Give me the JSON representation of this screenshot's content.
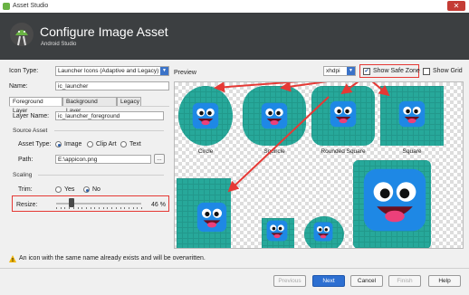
{
  "window": {
    "title": "Asset Studio",
    "close": "✕"
  },
  "header": {
    "title": "Configure Image Asset",
    "subtitle": "Android Studio"
  },
  "form": {
    "icon_type_label": "Icon Type:",
    "icon_type_value": "Launcher Icons (Adaptive and Legacy)",
    "name_label": "Name:",
    "name_value": "ic_launcher",
    "tabs": [
      "Foreground Layer",
      "Background Layer",
      "Legacy"
    ],
    "layer_name_label": "Layer Name:",
    "layer_name_value": "ic_launcher_foreground",
    "source_asset_label": "Source Asset",
    "asset_type_label": "Asset Type:",
    "asset_type_options": [
      "Image",
      "Clip Art",
      "Text"
    ],
    "asset_type_selected": "Image",
    "path_label": "Path:",
    "path_value": "E:\\appicon.png",
    "browse": "...",
    "scaling_label": "Scaling",
    "trim_label": "Trim:",
    "trim_options": [
      "Yes",
      "No"
    ],
    "trim_selected": "No",
    "resize_label": "Resize:",
    "resize_value": "46 %",
    "resize_fraction": 0.46
  },
  "preview": {
    "label": "Preview",
    "density_value": "xhdpi",
    "show_safe_zone": {
      "label": "Show Safe Zone",
      "checked": true
    },
    "show_grid": {
      "label": "Show Grid",
      "checked": false
    },
    "shapes": [
      "Circle",
      "Squircle",
      "Rounded Square",
      "Square"
    ]
  },
  "status": {
    "message": "An icon with the same name already exists and will be overwritten."
  },
  "buttons": {
    "previous": "Previous",
    "next": "Next",
    "cancel": "Cancel",
    "finish": "Finish",
    "help": "Help"
  },
  "colors": {
    "accent": "#2d6fd1",
    "icon_bg": "#27a89a",
    "icon_fg": "#1e88e5",
    "highlight": "#e53935"
  }
}
